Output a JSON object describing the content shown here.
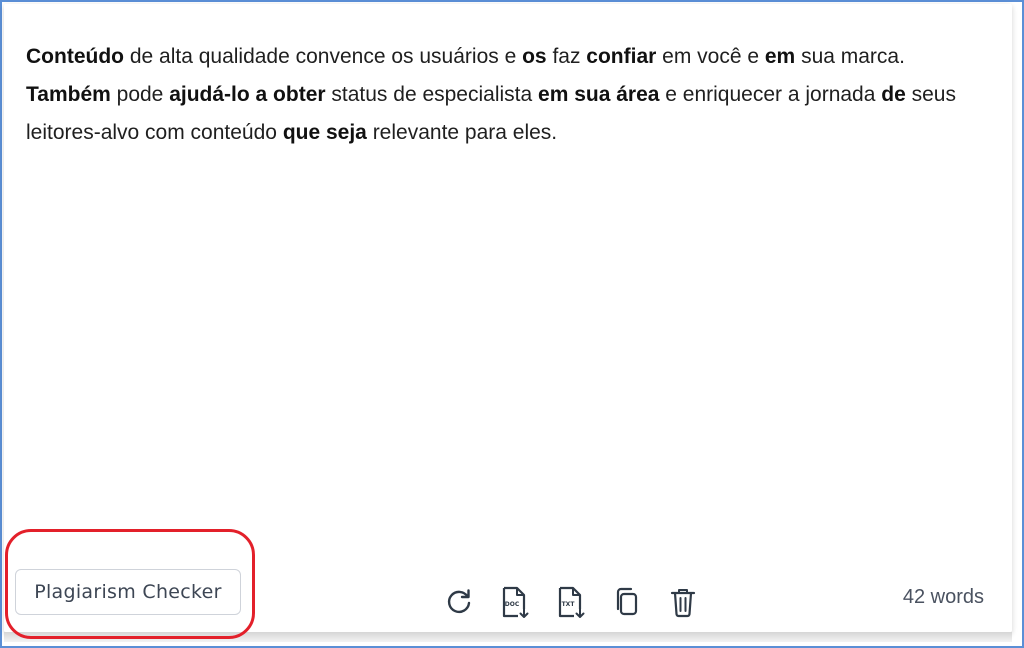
{
  "editor": {
    "segments": [
      {
        "text": "Conteúdo",
        "bold": true
      },
      {
        "text": " de alta qualidade convence os usuários e ",
        "bold": false
      },
      {
        "text": "os",
        "bold": true
      },
      {
        "text": " faz ",
        "bold": false
      },
      {
        "text": "confiar",
        "bold": true
      },
      {
        "text": " em você e ",
        "bold": false
      },
      {
        "text": "em",
        "bold": true
      },
      {
        "text": " sua marca. ",
        "bold": false
      },
      {
        "text": "Também",
        "bold": true
      },
      {
        "text": " pode ",
        "bold": false
      },
      {
        "text": "ajudá-lo a obter",
        "bold": true
      },
      {
        "text": " status de especialista ",
        "bold": false
      },
      {
        "text": "em sua área",
        "bold": true
      },
      {
        "text": " e enriquecer a jornada ",
        "bold": false
      },
      {
        "text": "de",
        "bold": true
      },
      {
        "text": " seus leitores-alvo com conteúdo ",
        "bold": false
      },
      {
        "text": "que seja",
        "bold": true
      },
      {
        "text": " relevante para eles.",
        "bold": false
      }
    ]
  },
  "footer": {
    "plagiarism_button_label": "Plagiarism Checker",
    "word_count": "42 words",
    "tools": [
      {
        "name": "refresh-icon"
      },
      {
        "name": "download-doc-icon",
        "badge": "DOC"
      },
      {
        "name": "download-txt-icon",
        "badge": "TXT"
      },
      {
        "name": "copy-icon"
      },
      {
        "name": "trash-icon"
      }
    ]
  },
  "colors": {
    "frame_border": "#5b8fd6",
    "highlight_ring": "#e3202a",
    "icon_stroke": "#2f3a47",
    "text": "#1f1f1f"
  }
}
